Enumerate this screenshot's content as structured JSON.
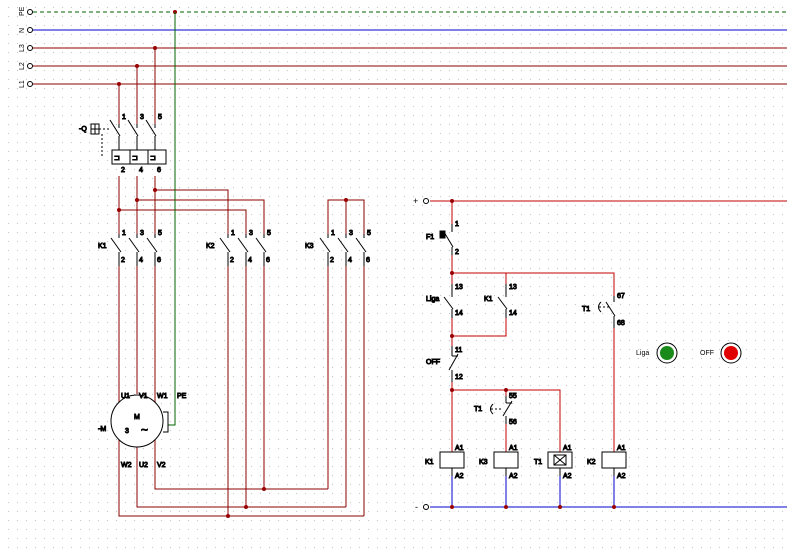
{
  "colors": {
    "phase": "#8b0000",
    "neutral": "#0000cc",
    "earth": "#006400",
    "control": "#c00000",
    "lamp_on": "#1a8a1a",
    "lamp_off": "#e00000",
    "junction": "#990000"
  },
  "bus": {
    "pe": "PE",
    "n": "N",
    "l3": "L3",
    "l2": "L2",
    "l1": "L1"
  },
  "breaker": {
    "tag": "-Q",
    "top": [
      "1",
      "3",
      "5"
    ],
    "bottom": [
      "2",
      "4",
      "6"
    ]
  },
  "contactors": [
    {
      "tag": "K1",
      "top": [
        "1",
        "3",
        "5"
      ],
      "bottom": [
        "2",
        "4",
        "6"
      ]
    },
    {
      "tag": "K2",
      "top": [
        "1",
        "3",
        "5"
      ],
      "bottom": [
        "2",
        "4",
        "6"
      ]
    },
    {
      "tag": "K3",
      "top": [
        "1",
        "3",
        "5"
      ],
      "bottom": [
        "2",
        "4",
        "6"
      ]
    }
  ],
  "motor": {
    "tag": "-M",
    "symbol": "M",
    "phases": "3",
    "wave": "~",
    "u1": "U1",
    "v1": "V1",
    "w1": "W1",
    "pe": "PE",
    "w2": "W2",
    "u2": "U2",
    "v2": "V2"
  },
  "control": {
    "plus": "+",
    "minus": "-",
    "f1": {
      "tag": "F1",
      "t1": "1",
      "t2": "2"
    },
    "liga": {
      "tag": "Liga",
      "t1": "13",
      "t2": "14"
    },
    "k1_aux": {
      "tag": "K1",
      "t1": "13",
      "t2": "14"
    },
    "off": {
      "tag": "OFF",
      "t1": "11",
      "t2": "12"
    },
    "t1_nc": {
      "tag": "T1",
      "t1": "55",
      "t2": "56"
    },
    "t1_no": {
      "tag": "T1",
      "t1": "67",
      "t2": "68"
    },
    "coils": [
      {
        "tag": "K1",
        "a1": "A1",
        "a2": "A2"
      },
      {
        "tag": "K3",
        "a1": "A1",
        "a2": "A2"
      },
      {
        "tag": "T1",
        "a1": "A1",
        "a2": "A2"
      },
      {
        "tag": "K2",
        "a1": "A1",
        "a2": "A2"
      }
    ]
  },
  "lamps": [
    {
      "label": "Liga",
      "state": "on"
    },
    {
      "label": "OFF",
      "state": "off"
    }
  ]
}
